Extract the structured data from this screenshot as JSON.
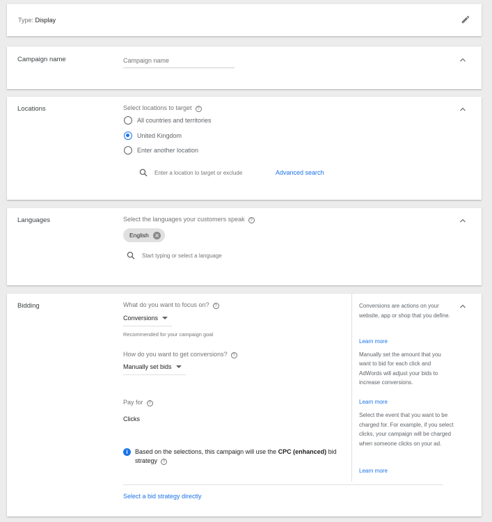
{
  "type_card": {
    "type_label": "Type:",
    "type_value": "Display"
  },
  "campaign_name": {
    "title": "Campaign name",
    "placeholder": "Campaign name"
  },
  "locations": {
    "title": "Locations",
    "prompt": "Select locations to target",
    "options": [
      {
        "label": "All countries and territories",
        "selected": false
      },
      {
        "label": "United Kingdom",
        "selected": true
      },
      {
        "label": "Enter another location",
        "selected": false
      }
    ],
    "search_placeholder": "Enter a location to target or exclude",
    "advanced_search": "Advanced search"
  },
  "languages": {
    "title": "Languages",
    "prompt": "Select the languages your customers speak",
    "chip": "English",
    "search_placeholder": "Start typing or select a language"
  },
  "bidding": {
    "title": "Bidding",
    "focus_question": "What do you want to focus on?",
    "focus_value": "Conversions",
    "focus_hint": "Recommended for your campaign goal",
    "how_question": "How do you want to get conversions?",
    "how_value": "Manually set bids",
    "pay_for_label": "Pay for",
    "pay_for_value": "Clicks",
    "info_prefix": "Based on the selections, this campaign will use the",
    "info_strategy": "CPC (enhanced)",
    "info_suffix": "bid",
    "info_line2": "strategy",
    "select_strategy_link": "Select a bid strategy directly",
    "help_texts": [
      {
        "text": "Conversions are actions on your website, app or shop that you define.",
        "link": "Learn more"
      },
      {
        "text": "Manually set the amount that you want to bid for each click and AdWords will adjust your bids to increase conversions.",
        "link": "Learn more"
      },
      {
        "text": "Select the event that you want to be charged for. For example, if you select clicks, your campaign will be charged when someone clicks on your ad.",
        "link": "Learn more"
      }
    ]
  },
  "colors": {
    "accent": "#1a73e8",
    "background": "#ececec",
    "card": "#ffffff"
  }
}
